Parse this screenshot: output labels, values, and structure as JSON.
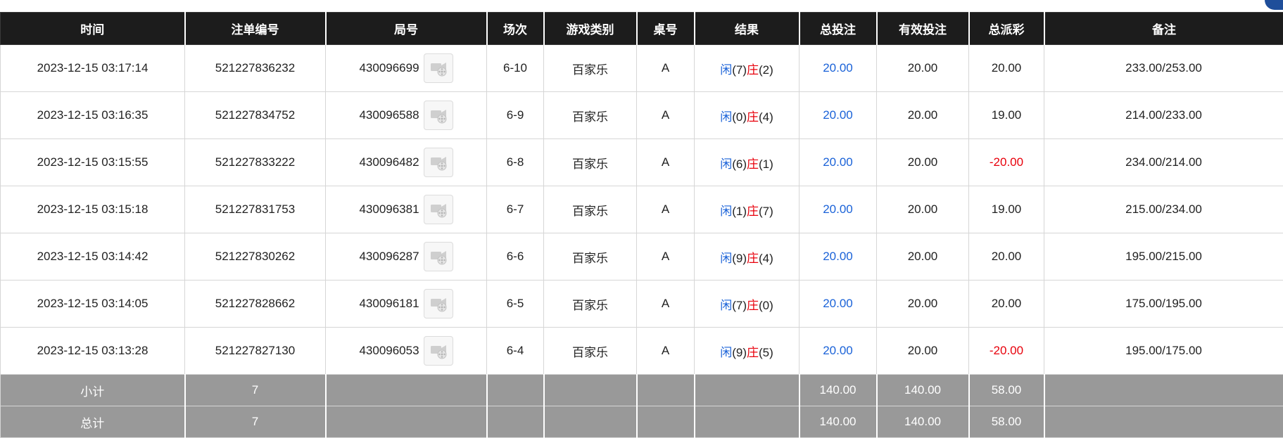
{
  "table": {
    "headers": [
      "时间",
      "注单编号",
      "局号",
      "场次",
      "游戏类别",
      "桌号",
      "结果",
      "总投注",
      "有效投注",
      "总派彩",
      "备注"
    ],
    "rows": [
      {
        "time": "2023-12-15 03:17:14",
        "bet_id": "521227836232",
        "round_id": "430096699",
        "session": "6-10",
        "game": "百家乐",
        "table": "A",
        "player_label": "闲",
        "player_score": "(7)",
        "banker_label": "庄",
        "banker_score": "(2)",
        "total_bet": "20.00",
        "valid_bet": "20.00",
        "payout": "20.00",
        "payout_negative": false,
        "note": "233.00/253.00"
      },
      {
        "time": "2023-12-15 03:16:35",
        "bet_id": "521227834752",
        "round_id": "430096588",
        "session": "6-9",
        "game": "百家乐",
        "table": "A",
        "player_label": "闲",
        "player_score": "(0)",
        "banker_label": "庄",
        "banker_score": "(4)",
        "total_bet": "20.00",
        "valid_bet": "20.00",
        "payout": "19.00",
        "payout_negative": false,
        "note": "214.00/233.00"
      },
      {
        "time": "2023-12-15 03:15:55",
        "bet_id": "521227833222",
        "round_id": "430096482",
        "session": "6-8",
        "game": "百家乐",
        "table": "A",
        "player_label": "闲",
        "player_score": "(6)",
        "banker_label": "庄",
        "banker_score": "(1)",
        "total_bet": "20.00",
        "valid_bet": "20.00",
        "payout": "-20.00",
        "payout_negative": true,
        "note": "234.00/214.00"
      },
      {
        "time": "2023-12-15 03:15:18",
        "bet_id": "521227831753",
        "round_id": "430096381",
        "session": "6-7",
        "game": "百家乐",
        "table": "A",
        "player_label": "闲",
        "player_score": "(1)",
        "banker_label": "庄",
        "banker_score": "(7)",
        "total_bet": "20.00",
        "valid_bet": "20.00",
        "payout": "19.00",
        "payout_negative": false,
        "note": "215.00/234.00"
      },
      {
        "time": "2023-12-15 03:14:42",
        "bet_id": "521227830262",
        "round_id": "430096287",
        "session": "6-6",
        "game": "百家乐",
        "table": "A",
        "player_label": "闲",
        "player_score": "(9)",
        "banker_label": "庄",
        "banker_score": "(4)",
        "total_bet": "20.00",
        "valid_bet": "20.00",
        "payout": "20.00",
        "payout_negative": false,
        "note": "195.00/215.00"
      },
      {
        "time": "2023-12-15 03:14:05",
        "bet_id": "521227828662",
        "round_id": "430096181",
        "session": "6-5",
        "game": "百家乐",
        "table": "A",
        "player_label": "闲",
        "player_score": "(7)",
        "banker_label": "庄",
        "banker_score": "(0)",
        "total_bet": "20.00",
        "valid_bet": "20.00",
        "payout": "20.00",
        "payout_negative": false,
        "note": "175.00/195.00"
      },
      {
        "time": "2023-12-15 03:13:28",
        "bet_id": "521227827130",
        "round_id": "430096053",
        "session": "6-4",
        "game": "百家乐",
        "table": "A",
        "player_label": "闲",
        "player_score": "(9)",
        "banker_label": "庄",
        "banker_score": "(5)",
        "total_bet": "20.00",
        "valid_bet": "20.00",
        "payout": "-20.00",
        "payout_negative": true,
        "note": "195.00/175.00"
      }
    ],
    "subtotal": {
      "label": "小计",
      "count": "7",
      "total_bet": "140.00",
      "valid_bet": "140.00",
      "payout": "58.00"
    },
    "total": {
      "label": "总计",
      "count": "7",
      "total_bet": "140.00",
      "valid_bet": "140.00",
      "payout": "58.00"
    }
  },
  "colors": {
    "header_bg": "#1c1c1c",
    "footer_bg": "#999999",
    "blue": "#1a62d8",
    "red": "#e8000b"
  },
  "icons": {
    "replay": "video-replay-icon"
  }
}
